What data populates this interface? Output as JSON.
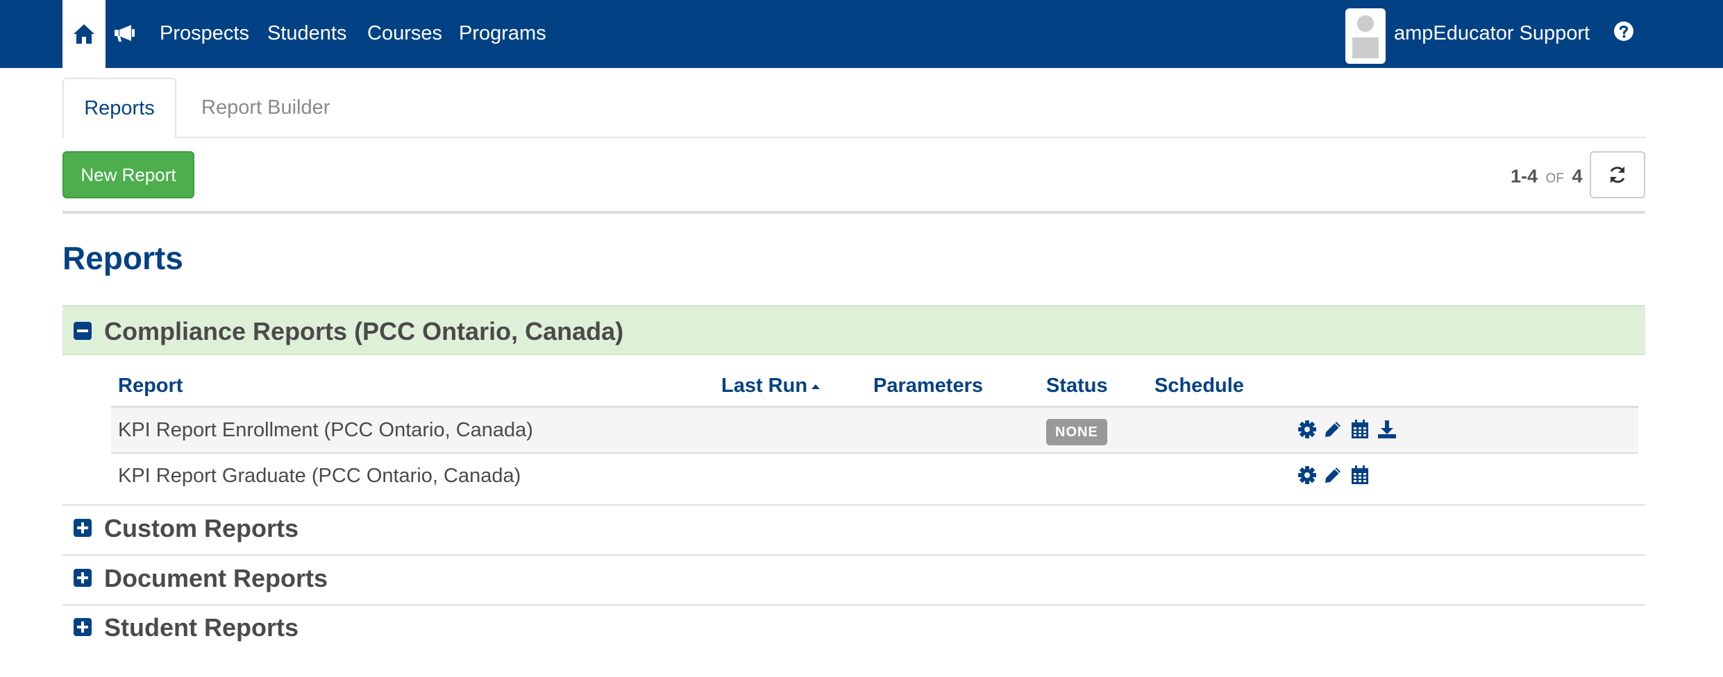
{
  "nav": {
    "links": [
      "Prospects",
      "Students",
      "Courses",
      "Programs"
    ],
    "user_name": "ampEducator Support"
  },
  "tabs": {
    "active": "Reports",
    "inactive": "Report Builder"
  },
  "toolbar": {
    "new_report_label": "New Report",
    "pager_range": "1-4",
    "pager_of": "OF",
    "pager_total": "4"
  },
  "page_title": "Reports",
  "groups": [
    {
      "title": "Compliance Reports (PCC Ontario, Canada)",
      "expanded": true
    },
    {
      "title": "Custom Reports",
      "expanded": false
    },
    {
      "title": "Document Reports",
      "expanded": false
    },
    {
      "title": "Student Reports",
      "expanded": false
    }
  ],
  "table": {
    "columns": [
      "Report",
      "Last Run",
      "Parameters",
      "Status",
      "Schedule"
    ],
    "rows": [
      {
        "name": "KPI Report Enrollment (PCC Ontario, Canada)",
        "status": "NONE",
        "actions": [
          "gear-icon",
          "pencil-icon",
          "calendar-icon",
          "download-icon"
        ]
      },
      {
        "name": "KPI Report Graduate (PCC Ontario, Canada)",
        "status": "",
        "actions": [
          "gear-icon",
          "pencil-icon",
          "calendar-icon"
        ]
      }
    ]
  },
  "colors": {
    "brand": "#034185",
    "success": "#4cae4c",
    "group_highlight": "#dff0d8",
    "badge": "#999999"
  }
}
